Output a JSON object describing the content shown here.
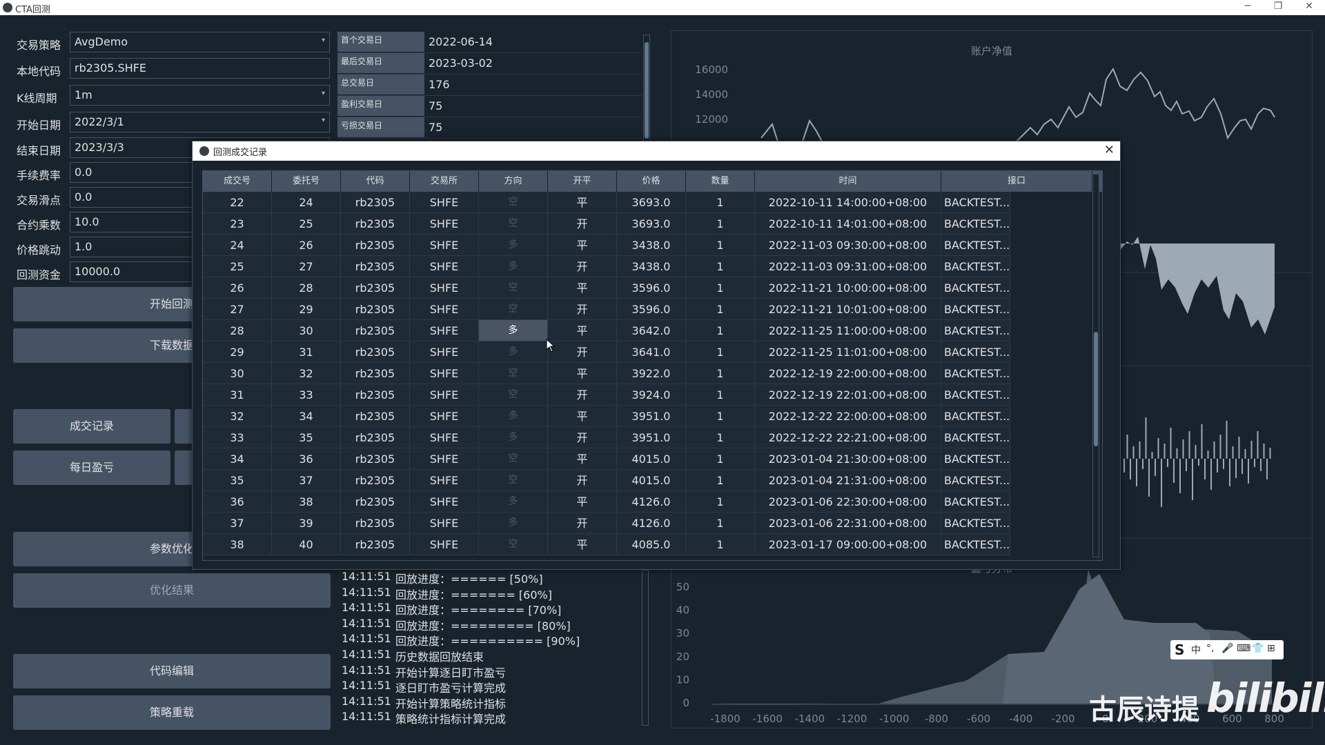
{
  "window": {
    "title": "CTA回测",
    "minimize": "─",
    "restore": "❐",
    "close": "✕"
  },
  "form": [
    {
      "label": "交易策略",
      "value": "AvgDemo",
      "dropdown": true
    },
    {
      "label": "本地代码",
      "value": "rb2305.SHFE",
      "dropdown": false
    },
    {
      "label": "K线周期",
      "value": "1m",
      "dropdown": true
    },
    {
      "label": "开始日期",
      "value": "2022/3/1",
      "dropdown": true
    },
    {
      "label": "结束日期",
      "value": "2023/3/3",
      "dropdown": false
    },
    {
      "label": "手续费率",
      "value": "0.0",
      "dropdown": false
    },
    {
      "label": "交易滑点",
      "value": "0.0",
      "dropdown": false
    },
    {
      "label": "合约乘数",
      "value": "10.0",
      "dropdown": false
    },
    {
      "label": "价格跳动",
      "value": "1.0",
      "dropdown": false
    },
    {
      "label": "回测资金",
      "value": "10000.0",
      "dropdown": false
    }
  ],
  "buttons": {
    "start_backtest": "开始回测",
    "download_data": "下载数据",
    "trade_records": "成交记录",
    "daily_pnl": "每日盈亏",
    "param_optimize": "参数优化",
    "optimize_result": "优化结果",
    "code_edit": "代码编辑",
    "strategy_reload": "策略重载"
  },
  "stats": [
    {
      "key": "首个交易日",
      "value": "2022-06-14"
    },
    {
      "key": "最后交易日",
      "value": "2023-03-02"
    },
    {
      "key": "总交易日",
      "value": "176"
    },
    {
      "key": "盈利交易日",
      "value": "75"
    },
    {
      "key": "亏损交易日",
      "value": "75"
    }
  ],
  "charts": {
    "balance_title": "账户净值",
    "balance_ticks": [
      "16000",
      "14000",
      "12000"
    ],
    "dist_title": "盈亏分布",
    "dist_yticks": [
      "50",
      "40",
      "30",
      "20",
      "10",
      "0"
    ],
    "dist_xticks": [
      "-1800",
      "-1600",
      "-1400",
      "-1200",
      "-1000",
      "-800",
      "-600",
      "-400",
      "-200",
      "0",
      "200",
      "400",
      "600",
      "800"
    ]
  },
  "log": [
    {
      "time": "14:11:51",
      "msg": "回放进度：====== [50%]"
    },
    {
      "time": "14:11:51",
      "msg": "回放进度：======= [60%]"
    },
    {
      "time": "14:11:51",
      "msg": "回放进度：======== [70%]"
    },
    {
      "time": "14:11:51",
      "msg": "回放进度：========= [80%]"
    },
    {
      "time": "14:11:51",
      "msg": "回放进度：========== [90%]"
    },
    {
      "time": "14:11:51",
      "msg": "历史数据回放结束"
    },
    {
      "time": "14:11:51",
      "msg": "开始计算逐日盯市盈亏"
    },
    {
      "time": "14:11:51",
      "msg": "逐日盯市盈亏计算完成"
    },
    {
      "time": "14:11:51",
      "msg": "开始计算策略统计指标"
    },
    {
      "time": "14:11:51",
      "msg": "策略统计指标计算完成"
    }
  ],
  "dialog": {
    "title": "回测成交记录",
    "close": "✕",
    "columns": [
      "成交号",
      "委托号",
      "代码",
      "交易所",
      "方向",
      "开平",
      "价格",
      "数量",
      "时间",
      "接口"
    ],
    "rows": [
      [
        "22",
        "24",
        "rb2305",
        "SHFE",
        "空",
        "平",
        "3693.0",
        "1",
        "2022-10-11 14:00:00+08:00",
        "BACKTEST..."
      ],
      [
        "23",
        "25",
        "rb2305",
        "SHFE",
        "空",
        "开",
        "3693.0",
        "1",
        "2022-10-11 14:01:00+08:00",
        "BACKTEST..."
      ],
      [
        "24",
        "26",
        "rb2305",
        "SHFE",
        "多",
        "平",
        "3438.0",
        "1",
        "2022-11-03 09:30:00+08:00",
        "BACKTEST..."
      ],
      [
        "25",
        "27",
        "rb2305",
        "SHFE",
        "多",
        "开",
        "3438.0",
        "1",
        "2022-11-03 09:31:00+08:00",
        "BACKTEST..."
      ],
      [
        "26",
        "28",
        "rb2305",
        "SHFE",
        "空",
        "平",
        "3596.0",
        "1",
        "2022-11-21 10:00:00+08:00",
        "BACKTEST..."
      ],
      [
        "27",
        "29",
        "rb2305",
        "SHFE",
        "空",
        "开",
        "3596.0",
        "1",
        "2022-11-21 10:01:00+08:00",
        "BACKTEST..."
      ],
      [
        "28",
        "30",
        "rb2305",
        "SHFE",
        "多",
        "平",
        "3642.0",
        "1",
        "2022-11-25 11:00:00+08:00",
        "BACKTEST..."
      ],
      [
        "29",
        "31",
        "rb2305",
        "SHFE",
        "多",
        "开",
        "3641.0",
        "1",
        "2022-11-25 11:01:00+08:00",
        "BACKTEST..."
      ],
      [
        "30",
        "32",
        "rb2305",
        "SHFE",
        "空",
        "平",
        "3922.0",
        "1",
        "2022-12-19 22:00:00+08:00",
        "BACKTEST..."
      ],
      [
        "31",
        "33",
        "rb2305",
        "SHFE",
        "空",
        "开",
        "3924.0",
        "1",
        "2022-12-19 22:01:00+08:00",
        "BACKTEST..."
      ],
      [
        "32",
        "34",
        "rb2305",
        "SHFE",
        "多",
        "平",
        "3951.0",
        "1",
        "2022-12-22 22:00:00+08:00",
        "BACKTEST..."
      ],
      [
        "33",
        "35",
        "rb2305",
        "SHFE",
        "多",
        "开",
        "3951.0",
        "1",
        "2022-12-22 22:21:00+08:00",
        "BACKTEST..."
      ],
      [
        "34",
        "36",
        "rb2305",
        "SHFE",
        "空",
        "平",
        "4015.0",
        "1",
        "2023-01-04 21:30:00+08:00",
        "BACKTEST..."
      ],
      [
        "35",
        "37",
        "rb2305",
        "SHFE",
        "空",
        "开",
        "4015.0",
        "1",
        "2023-01-04 21:31:00+08:00",
        "BACKTEST..."
      ],
      [
        "36",
        "38",
        "rb2305",
        "SHFE",
        "多",
        "平",
        "4126.0",
        "1",
        "2023-01-06 22:30:00+08:00",
        "BACKTEST..."
      ],
      [
        "37",
        "39",
        "rb2305",
        "SHFE",
        "多",
        "开",
        "4126.0",
        "1",
        "2023-01-06 22:31:00+08:00",
        "BACKTEST..."
      ],
      [
        "38",
        "40",
        "rb2305",
        "SHFE",
        "空",
        "平",
        "4085.0",
        "1",
        "2023-01-17 09:00:00+08:00",
        "BACKTEST..."
      ]
    ],
    "selected_cell": {
      "row": 6,
      "col": 4
    }
  },
  "ime": {
    "logo": "S",
    "items": [
      "中",
      "°,",
      "🎤",
      "⌨",
      "👕",
      "⊞"
    ]
  },
  "watermark": {
    "text": "古辰诗提",
    "logo": "bilibili"
  },
  "colors": {
    "background": "#19232d",
    "panel": "#455364",
    "text": "#e0e1e3",
    "series": "#9da9b5"
  }
}
